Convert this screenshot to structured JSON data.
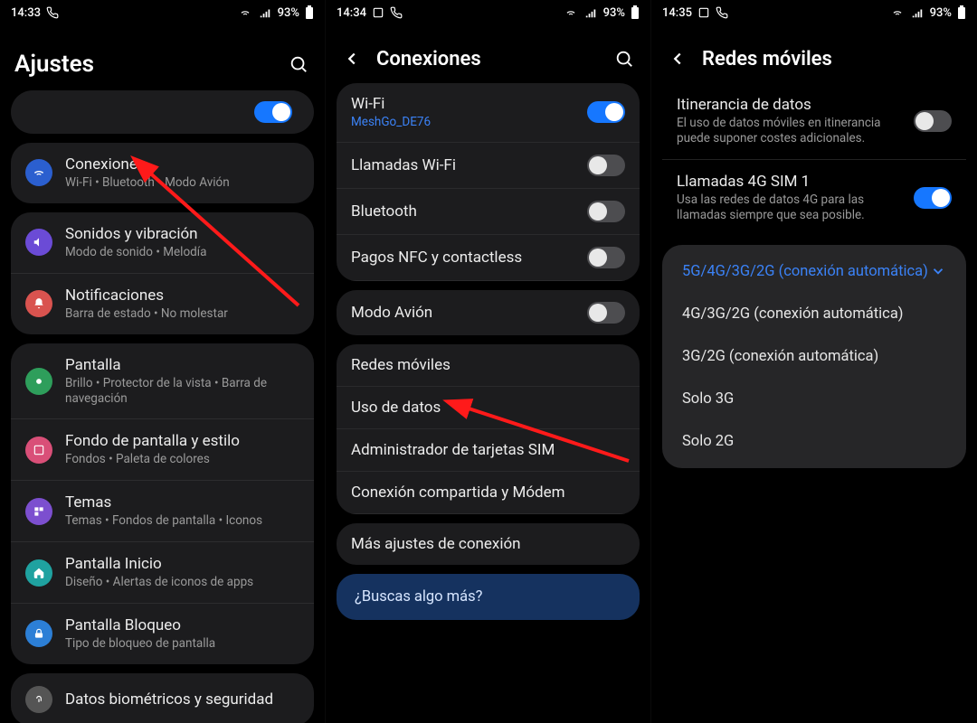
{
  "status": {
    "s1": {
      "time": "14:33",
      "battery": "93%"
    },
    "s2": {
      "time": "14:34",
      "battery": "93%"
    },
    "s3": {
      "time": "14:35",
      "battery": "93%"
    }
  },
  "screen1": {
    "title": "Ajustes",
    "items": [
      {
        "label": "Conexiones",
        "sub": "Wi-Fi  •  Bluetooth  •  Modo Avión"
      },
      {
        "label": "Sonidos y vibración",
        "sub": "Modo de sonido  •  Melodía"
      },
      {
        "label": "Notificaciones",
        "sub": "Barra de estado  •  No molestar"
      },
      {
        "label": "Pantalla",
        "sub": "Brillo  •  Protector de la vista  •  Barra de navegación"
      },
      {
        "label": "Fondo de pantalla y estilo",
        "sub": "Fondos  •  Paleta de colores"
      },
      {
        "label": "Temas",
        "sub": "Temas  •  Fondos de pantalla  •  Iconos"
      },
      {
        "label": "Pantalla Inicio",
        "sub": "Diseño  •  Alertas de iconos de apps"
      },
      {
        "label": "Pantalla Bloqueo",
        "sub": "Tipo de bloqueo de pantalla"
      },
      {
        "label": "Datos biométricos y seguridad",
        "sub": ""
      }
    ]
  },
  "screen2": {
    "title": "Conexiones",
    "group1": [
      {
        "label": "Wi-Fi",
        "sub": "MeshGo_DE76",
        "toggle": true,
        "on": true
      },
      {
        "label": "Llamadas Wi-Fi",
        "toggle": true,
        "on": false
      },
      {
        "label": "Bluetooth",
        "toggle": true,
        "on": false
      },
      {
        "label": "Pagos NFC y contactless",
        "toggle": true,
        "on": false
      }
    ],
    "group2": [
      {
        "label": "Modo Avión",
        "toggle": true,
        "on": false
      }
    ],
    "group3": [
      {
        "label": "Redes móviles"
      },
      {
        "label": "Uso de datos"
      },
      {
        "label": "Administrador de tarjetas SIM"
      },
      {
        "label": "Conexión compartida y Módem"
      }
    ],
    "group4": [
      {
        "label": "Más ajustes de conexión"
      }
    ],
    "banner": "¿Buscas algo más?"
  },
  "screen3": {
    "title": "Redes móviles",
    "rows": [
      {
        "label": "Itinerancia de datos",
        "sub": "El uso de datos móviles en itinerancia puede suponer costes adicionales.",
        "toggle": true,
        "on": false
      },
      {
        "label": "Llamadas 4G SIM 1",
        "sub": "Usa las redes de datos 4G para las llamadas siempre que sea posible.",
        "toggle": true,
        "on": true
      }
    ],
    "options": [
      "5G/4G/3G/2G (conexión automática)",
      "4G/3G/2G (conexión automática)",
      "3G/2G (conexión automática)",
      "Solo 3G",
      "Solo 2G"
    ]
  }
}
